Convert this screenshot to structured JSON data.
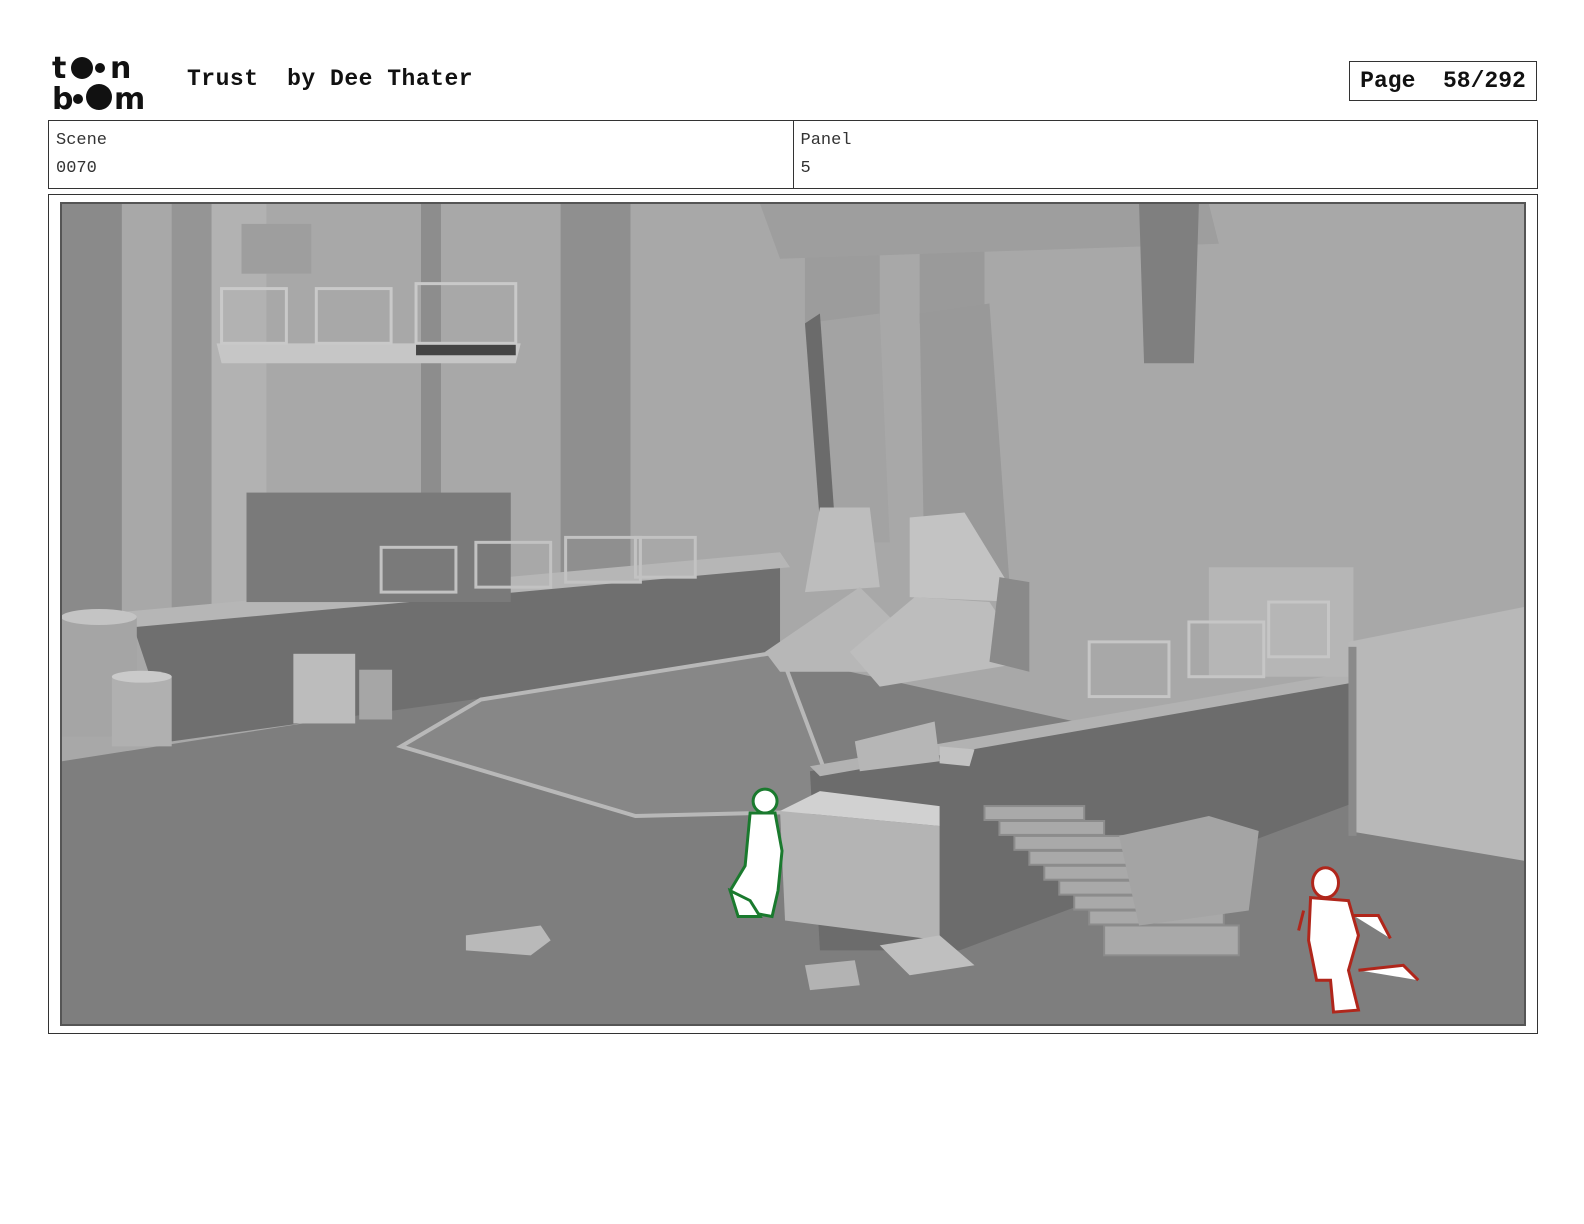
{
  "header": {
    "logo_alt": "toon boom",
    "title": "Trust  by Dee Thater",
    "page_label": "Page  58/292"
  },
  "info": {
    "scene_label": "Scene",
    "scene_value": "0070",
    "panel_label": "Panel",
    "panel_value": "5"
  },
  "panel": {
    "description_icons": [
      "robot-feet",
      "catwalk",
      "stairs",
      "crates"
    ],
    "colors": {
      "floor": "#7d7d7d",
      "wall": "#a6a6a6",
      "figure_green": "#1a7a2e",
      "figure_red": "#b0261b"
    }
  }
}
